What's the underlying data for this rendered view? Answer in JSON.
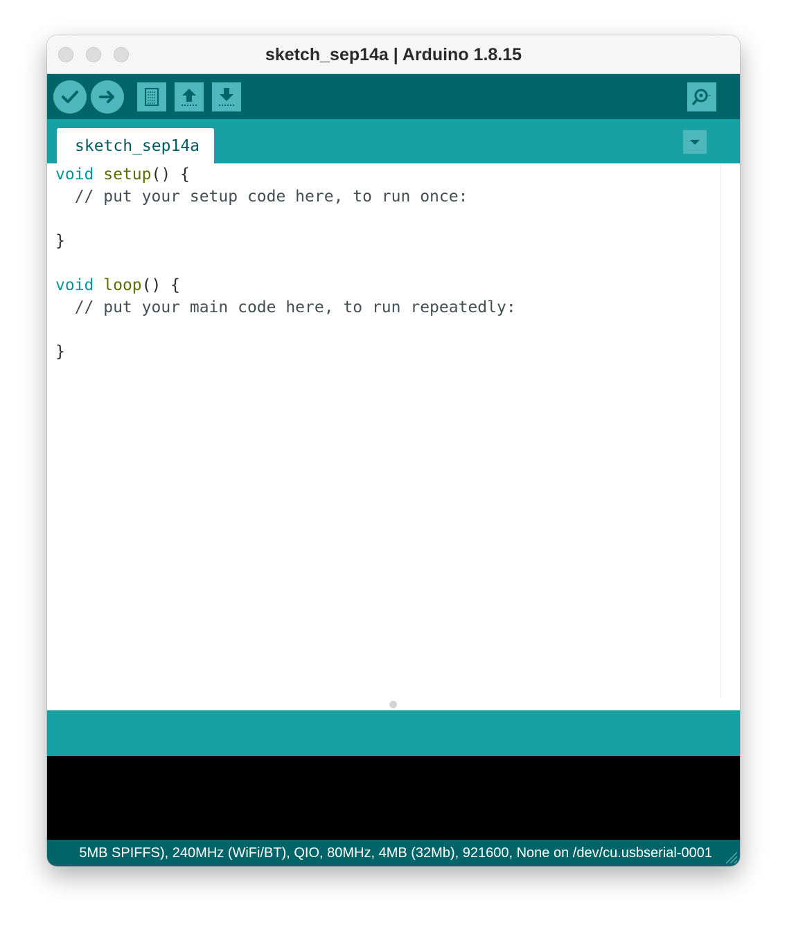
{
  "window": {
    "title": "sketch_sep14a | Arduino 1.8.15"
  },
  "toolbar": {
    "buttons": [
      {
        "name": "verify",
        "icon": "checkmark-icon"
      },
      {
        "name": "upload",
        "icon": "arrow-right-icon"
      },
      {
        "name": "new",
        "icon": "new-file-icon"
      },
      {
        "name": "open",
        "icon": "arrow-up-icon"
      },
      {
        "name": "save",
        "icon": "arrow-down-icon"
      },
      {
        "name": "serial-monitor",
        "icon": "magnifier-icon"
      }
    ]
  },
  "tabs": {
    "active": "sketch_sep14a",
    "menu_icon": "triangle-down-icon"
  },
  "editor": {
    "lines": [
      [
        {
          "t": "void",
          "c": "kw"
        },
        {
          "t": " "
        },
        {
          "t": "setup",
          "c": "fn"
        },
        {
          "t": "() {"
        }
      ],
      [
        {
          "t": "  // put your setup code here, to run once:",
          "c": "cm"
        }
      ],
      [
        {
          "t": ""
        }
      ],
      [
        {
          "t": "}"
        }
      ],
      [
        {
          "t": ""
        }
      ],
      [
        {
          "t": "void",
          "c": "kw"
        },
        {
          "t": " "
        },
        {
          "t": "loop",
          "c": "fn"
        },
        {
          "t": "() {"
        }
      ],
      [
        {
          "t": "  // put your main code here, to run repeatedly:",
          "c": "cm"
        }
      ],
      [
        {
          "t": ""
        }
      ],
      [
        {
          "t": "}"
        }
      ]
    ]
  },
  "footer": {
    "board_status": "5MB SPIFFS), 240MHz (WiFi/BT), QIO, 80MHz, 4MB (32Mb), 921600, None on /dev/cu.usbserial-0001"
  },
  "colors": {
    "toolbar": "#006468",
    "tabstrip": "#17a1a5",
    "button": "#4db7bb",
    "keyword": "#00979c",
    "function": "#5e6d03",
    "console": "#000000"
  }
}
